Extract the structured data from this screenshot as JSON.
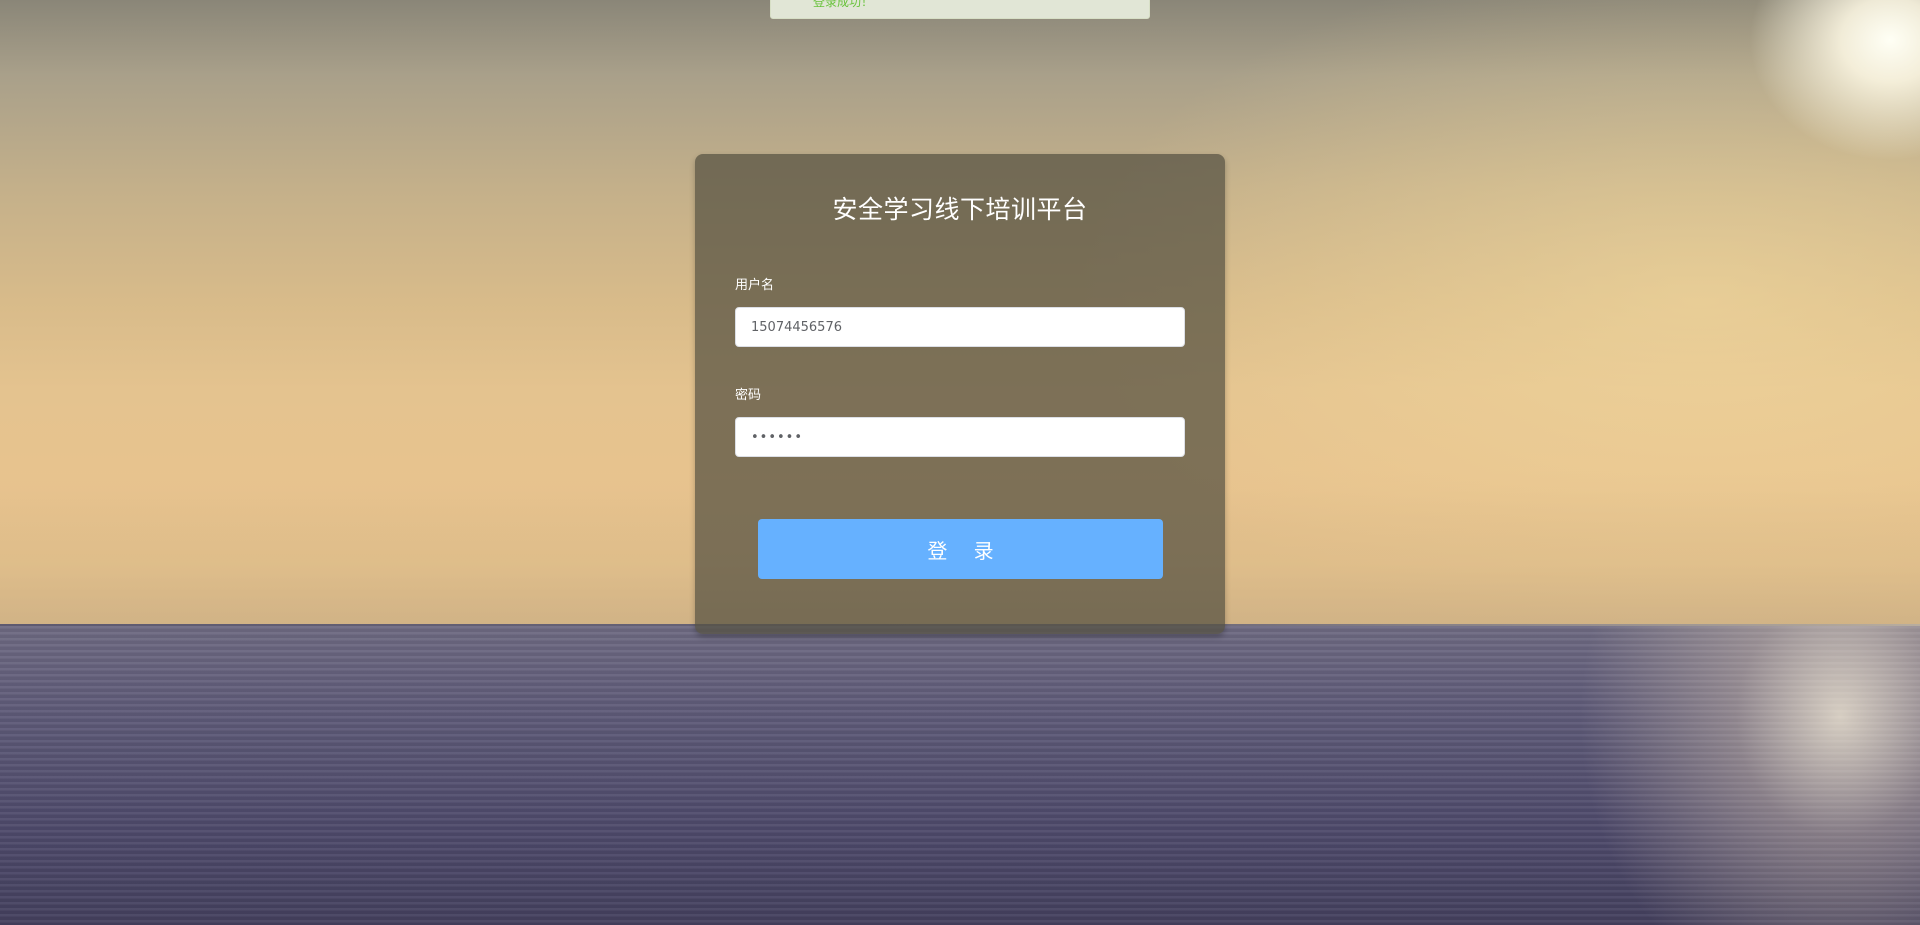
{
  "alert": {
    "message": "登录成功！",
    "color": "#67c23a"
  },
  "login_form": {
    "title": "安全学习线下培训平台",
    "username_label": "用户名",
    "username_value": "15074456576",
    "password_label": "密码",
    "password_value": "123456",
    "login_button": "登 录"
  },
  "colors": {
    "button": "#66b1ff",
    "panel": "rgba(85, 80, 65, 0.72)"
  }
}
